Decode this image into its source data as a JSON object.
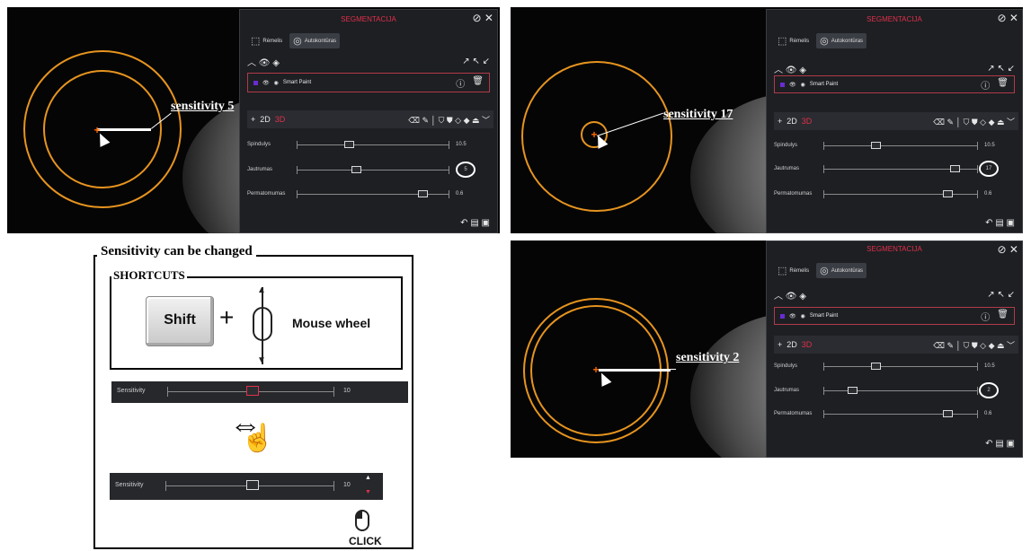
{
  "panel": {
    "title": "SEGMENTACIJA",
    "header_icons": "?⃝ ✕",
    "tabs": [
      {
        "label": "Rėmelis"
      },
      {
        "label": "Autokontūras"
      }
    ],
    "layer_name": "Smart Paint",
    "mode_2d": "2D",
    "mode_3d": "3D",
    "sliders": {
      "radius_label": "Spindulys",
      "radius_value": "10.5",
      "sensitivity_label": "Jautrumas",
      "permeability_label": "Permatomumas",
      "permeability_value": "0.6"
    }
  },
  "screenshots": [
    {
      "callout": "sensitivity 5",
      "sensitivity_value": "5"
    },
    {
      "callout": "sensitivity 17",
      "sensitivity_value": "17"
    },
    {
      "callout": "sensitivity 2",
      "sensitivity_value": "2"
    }
  ],
  "legend": {
    "title": "Sensitivity can be changed",
    "shortcuts_title": "SHORTCUTS",
    "shift_key": "Shift",
    "plus": "+",
    "mouse_wheel": "Mouse wheel",
    "sensitivity_label": "Sensitivity",
    "sensitivity_value": "10",
    "click_label": "CLICK"
  },
  "colors": {
    "accent_red": "#e0304a",
    "ring_orange": "#e6941f",
    "panel_bg": "#1d1f23"
  }
}
